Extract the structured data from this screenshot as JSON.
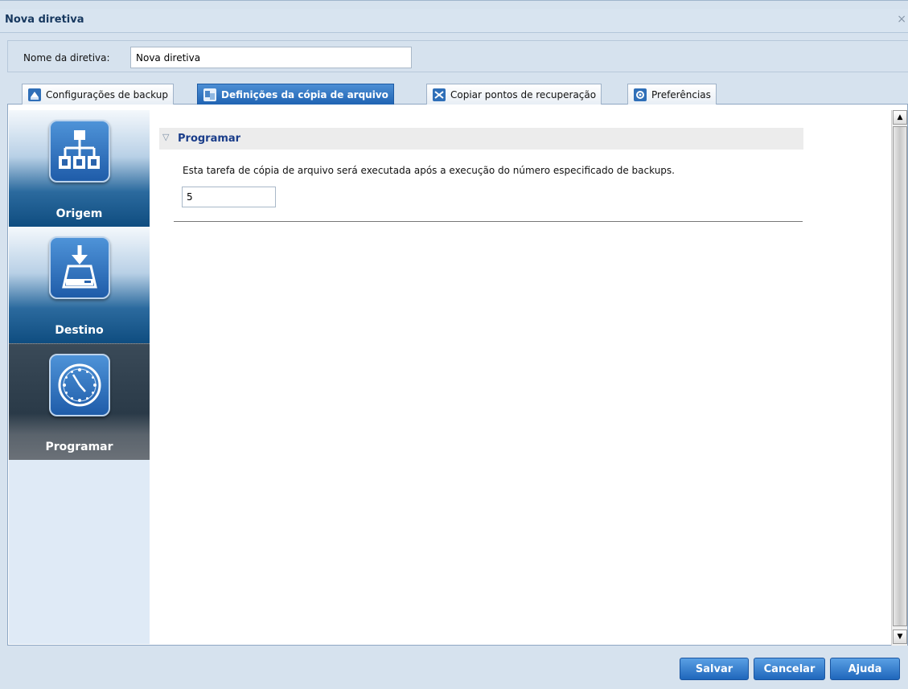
{
  "window": {
    "title": "Nova diretiva",
    "close_glyph": "×"
  },
  "policy": {
    "name_label": "Nome da diretiva:",
    "name_value": "Nova diretiva"
  },
  "tabs": [
    {
      "label": "Configurações de backup",
      "icon": "backup-icon",
      "active": false
    },
    {
      "label": "Definições da cópia de arquivo",
      "icon": "file-copy-icon",
      "active": true
    },
    {
      "label": "Copiar pontos de recuperação",
      "icon": "copy-recovery-icon",
      "active": false
    },
    {
      "label": "Preferências",
      "icon": "preferences-icon",
      "active": false
    }
  ],
  "sidebar": {
    "items": [
      {
        "label": "Origem",
        "icon": "network-tree-icon"
      },
      {
        "label": "Destino",
        "icon": "drive-download-icon"
      },
      {
        "label": "Programar",
        "icon": "clock-icon",
        "active": true
      }
    ]
  },
  "section": {
    "title": "Programar",
    "description": "Esta tarefa de cópia de arquivo será executada após a execução do número especificado de backups.",
    "backup_count": "5"
  },
  "footer": {
    "save": "Salvar",
    "cancel": "Cancelar",
    "help": "Ajuda"
  },
  "colors": {
    "accent": "#1f66bb",
    "section_title": "#1a3d8a",
    "window_bg": "#d6e2ee"
  }
}
